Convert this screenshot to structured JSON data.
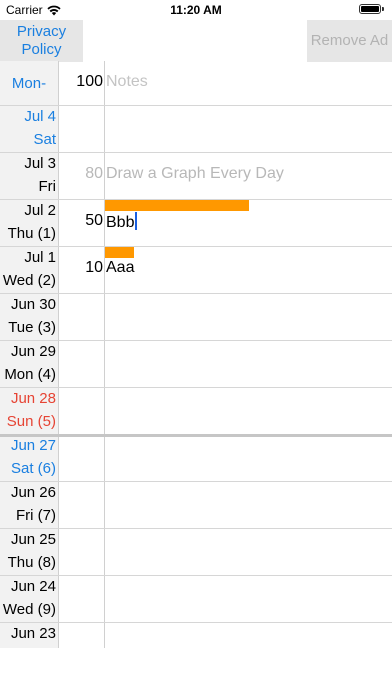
{
  "status_bar": {
    "carrier": "Carrier",
    "time": "11:20 AM"
  },
  "toolbar": {
    "privacy_label": "Privacy Policy",
    "remove_ad_label": "Remove Ad"
  },
  "header": {
    "day_label": "Mon-",
    "max_value": "100",
    "notes_placeholder": "Notes"
  },
  "rows": [
    {
      "line1": "Jul 4",
      "line2": "Sat",
      "color": "#1a7fe0"
    },
    {
      "line1": "Jul 3",
      "line2": "Fri",
      "color": "#000000"
    },
    {
      "line1": "Jul 2",
      "line2": "Thu (1)",
      "color": "#000000"
    },
    {
      "line1": "Jul 1",
      "line2": "Wed (2)",
      "color": "#000000"
    },
    {
      "line1": "Jun 30",
      "line2": "Tue (3)",
      "color": "#000000"
    },
    {
      "line1": "Jun 29",
      "line2": "Mon (4)",
      "color": "#000000"
    },
    {
      "line1": "Jun 28",
      "line2": "Sun (5)",
      "color": "#e64434"
    },
    {
      "line1": "Jun 27",
      "line2": "Sat (6)",
      "color": "#1a7fe0"
    },
    {
      "line1": "Jun 26",
      "line2": "Fri (7)",
      "color": "#000000"
    },
    {
      "line1": "Jun 25",
      "line2": "Thu (8)",
      "color": "#000000"
    },
    {
      "line1": "Jun 24",
      "line2": "Wed (9)",
      "color": "#000000"
    },
    {
      "line1": "Jun 23",
      "line2": "",
      "color": "#000000"
    }
  ],
  "entries": [
    {
      "value": "80",
      "text": "Draw a Graph Every Day",
      "placeholder": true,
      "bar_fraction": 0
    },
    {
      "value": "50",
      "text": "Bbb",
      "placeholder": false,
      "bar_fraction": 0.5
    },
    {
      "value": "10",
      "text": "Aaa",
      "placeholder": false,
      "bar_fraction": 0.1
    }
  ],
  "colors": {
    "bar": "#ff9800",
    "accent": "#1a7fe0",
    "sunday": "#e64434"
  },
  "battery_level": 1.0
}
